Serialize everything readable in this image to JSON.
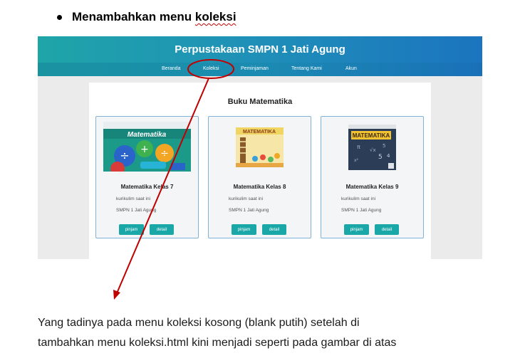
{
  "heading": {
    "words": [
      "Menambahkan",
      "menu",
      "koleksi"
    ]
  },
  "website": {
    "title": "Perpustakaan SMPN 1 Jati Agung",
    "nav": [
      {
        "label": "Beranda"
      },
      {
        "label": "Koleksi"
      },
      {
        "label": "Peminjaman"
      },
      {
        "label": "Tentang Kami"
      },
      {
        "label": "Akun"
      }
    ],
    "section_title": "Buku Matematika",
    "cards": [
      {
        "title": "Matematika Kelas 7",
        "line1": "kurikulim saat ini",
        "line2": "SMPN 1 Jati Agung",
        "btn_borrow": "pinjam",
        "btn_detail": "detail",
        "cover_text": "Matematika"
      },
      {
        "title": "Matematika Kelas 8",
        "line1": "kurikulim saat ini",
        "line2": "SMPN 1 Jati Agung",
        "btn_borrow": "pinjam",
        "btn_detail": "detail",
        "cover_text": "MATEMATIKA"
      },
      {
        "title": "Matematika Kelas 9",
        "line1": "kurikulim saat ini",
        "line2": "SMPN 1 Jati Agung",
        "btn_borrow": "pinjam",
        "btn_detail": "detail",
        "cover_text": "MATEMATIKA"
      }
    ]
  },
  "caption": {
    "line1": "Yang tadinya pada menu koleksi kosong (blank putih) setelah di",
    "line2": "tambahkan menu koleksi.html kini menjadi seperti pada gambar di atas"
  },
  "colors": {
    "annotation": "#c00000",
    "header_teal": "#1fa5a8",
    "button": "#1aa7a7"
  },
  "annotation": {
    "type": "red ellipse around Koleksi with arrow pointing down-left"
  }
}
